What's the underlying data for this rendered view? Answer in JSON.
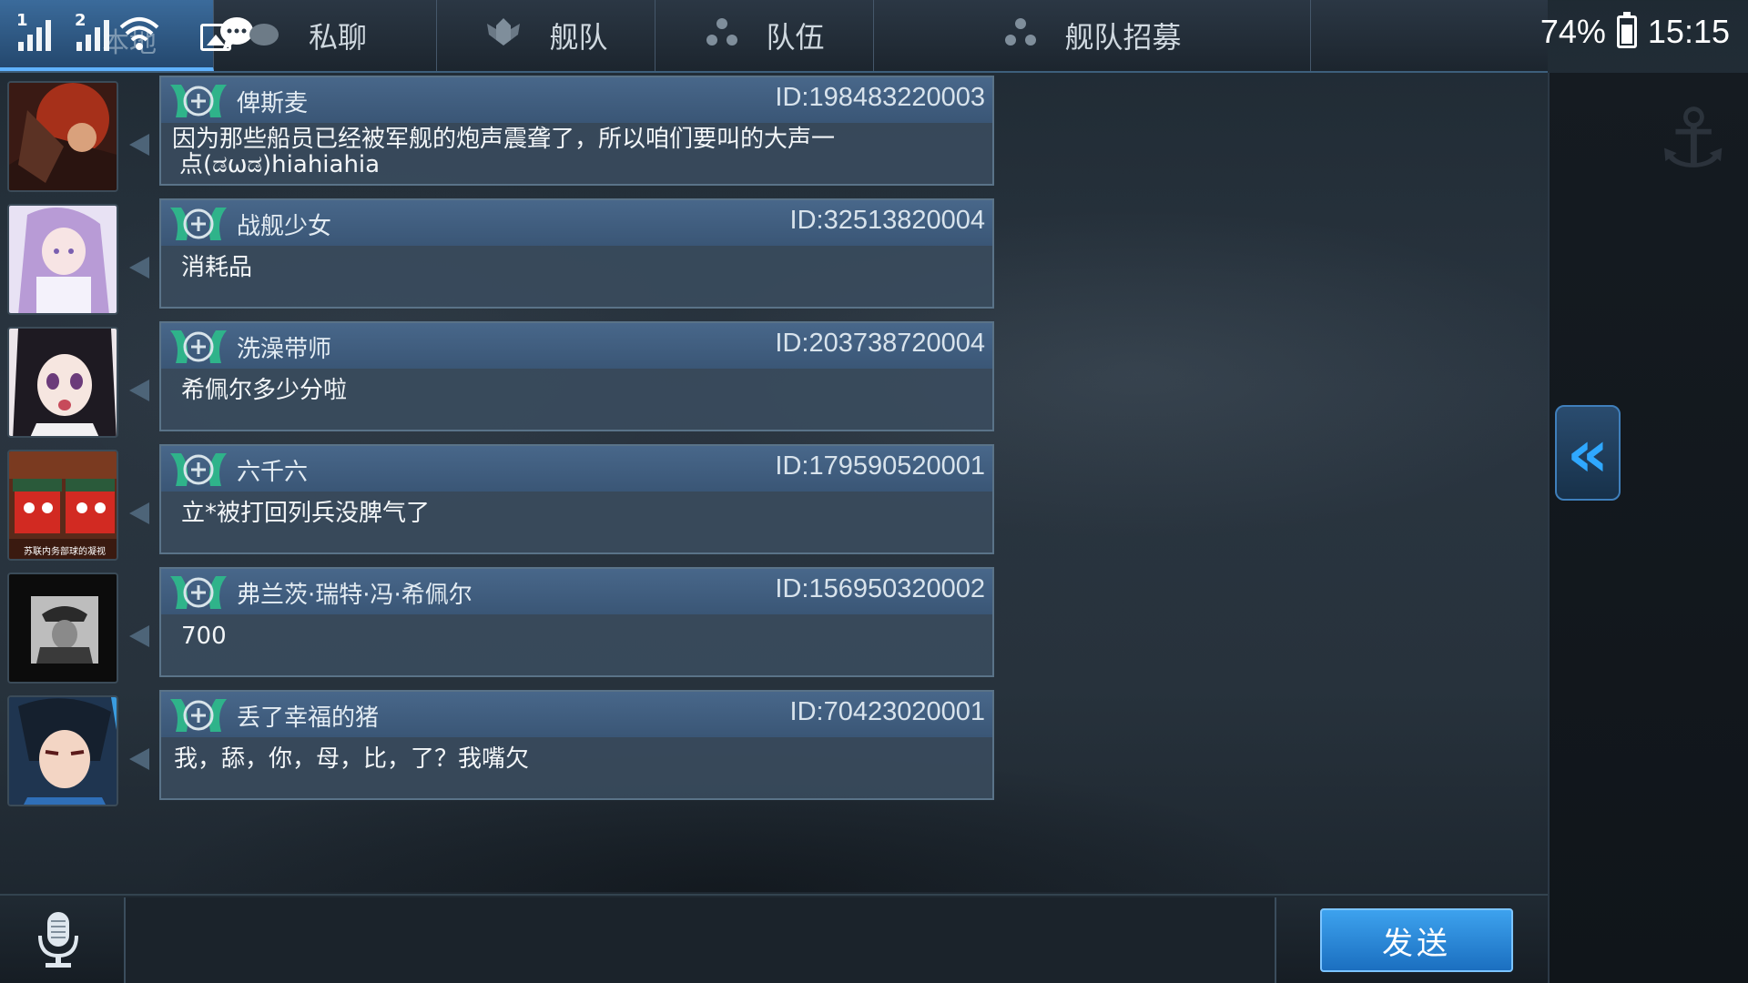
{
  "status": {
    "battery": "74%",
    "time": "15:15",
    "sim1": "1",
    "sim2": "2"
  },
  "tabs": {
    "world": "本地",
    "private": "私聊",
    "fleet": "舰队",
    "team": "队伍",
    "recruit": "舰队招募"
  },
  "messages": [
    {
      "sender": "俾斯麦",
      "id": "ID:198483220003",
      "text_line1": "因为那些船员已经被军舰的炮声震聋了，所以咱们要叫的大声一",
      "text_line2": "点(ಡωಡ)hiahiahia"
    },
    {
      "sender": "战舰少女",
      "id": "ID:32513820004",
      "text": "消耗品"
    },
    {
      "sender": "洗澡带师",
      "id": "ID:203738720004",
      "text": "希佩尔多少分啦"
    },
    {
      "sender": "六千六",
      "id": "ID:179590520001",
      "text": "立*被打回列兵没脾气了",
      "avatar_caption": "苏联内务部球的凝视"
    },
    {
      "sender": "弗兰茨·瑞特·冯·希佩尔",
      "id": "ID:156950320002",
      "text": "700"
    },
    {
      "sender": "丢了幸福的猪",
      "id": "ID:70423020001",
      "text": "我，舔，你，母，比，了？我嘴欠"
    }
  ],
  "input": {
    "placeholder": "",
    "value": ""
  },
  "send_label": "发送",
  "colors": {
    "accent": "#2fa8ff",
    "bubble_header": "#48678a",
    "send_button": "#2a8ad8"
  }
}
